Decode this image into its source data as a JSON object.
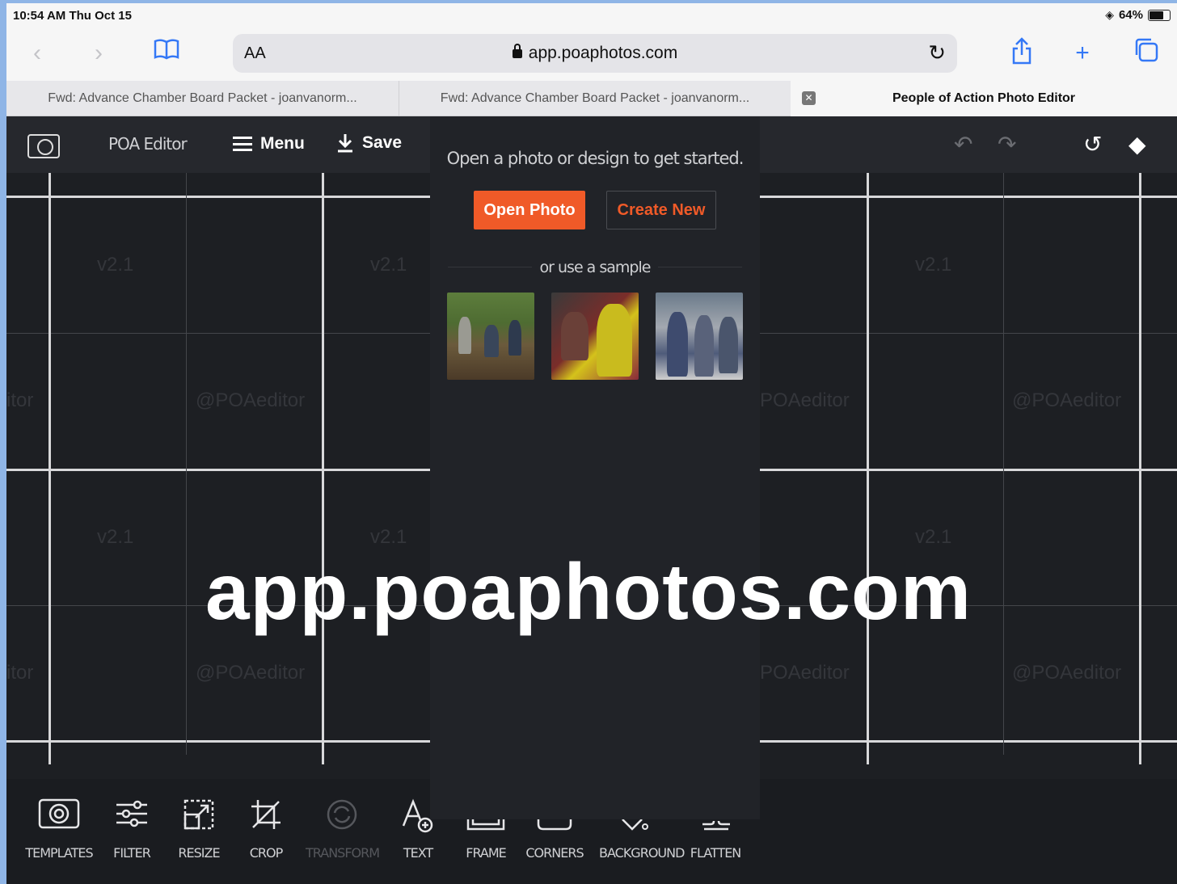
{
  "status_bar": {
    "time": "10:54 AM  Thu Oct 15",
    "battery": "64%"
  },
  "browser": {
    "text_size": "AA",
    "url": "app.poaphotos.com",
    "tabs": [
      {
        "title": "Fwd: Advance Chamber Board Packet - joanvanorm..."
      },
      {
        "title": "Fwd: Advance Chamber Board Packet - joanvanorm..."
      },
      {
        "title": "People of Action Photo Editor"
      }
    ]
  },
  "app": {
    "name": "POA Editor",
    "menu_label": "Menu",
    "save_label": "Save"
  },
  "canvas": {
    "watermark_version": "v2.1",
    "watermark_handle": "@POAeditor",
    "watermark_handle_cut": "POAeditor",
    "watermark_handle_edge": "itor"
  },
  "panel": {
    "prompt": "Open a photo or design to get started.",
    "open_photo": "Open Photo",
    "create_new": "Create New",
    "sample_label": "or use a sample"
  },
  "tools": [
    {
      "label": "TEMPLATES",
      "icon": "camera-icon"
    },
    {
      "label": "FILTER",
      "icon": "sliders-icon"
    },
    {
      "label": "RESIZE",
      "icon": "resize-icon"
    },
    {
      "label": "CROP",
      "icon": "crop-icon"
    },
    {
      "label": "TRANSFORM",
      "icon": "rotate-icon",
      "disabled": true
    },
    {
      "label": "TEXT",
      "icon": "text-add-icon"
    },
    {
      "label": "FRAME",
      "icon": "frame-icon"
    },
    {
      "label": "CORNERS",
      "icon": "corners-icon"
    },
    {
      "label": "BACKGROUND",
      "icon": "paint-bucket-icon"
    },
    {
      "label": "FLATTEN",
      "icon": "flatten-icon"
    }
  ],
  "caption": "app.poaphotos.com",
  "colors": {
    "accent": "#f05a28",
    "browser_blue": "#3478f6",
    "app_bg": "#1d1f23"
  }
}
